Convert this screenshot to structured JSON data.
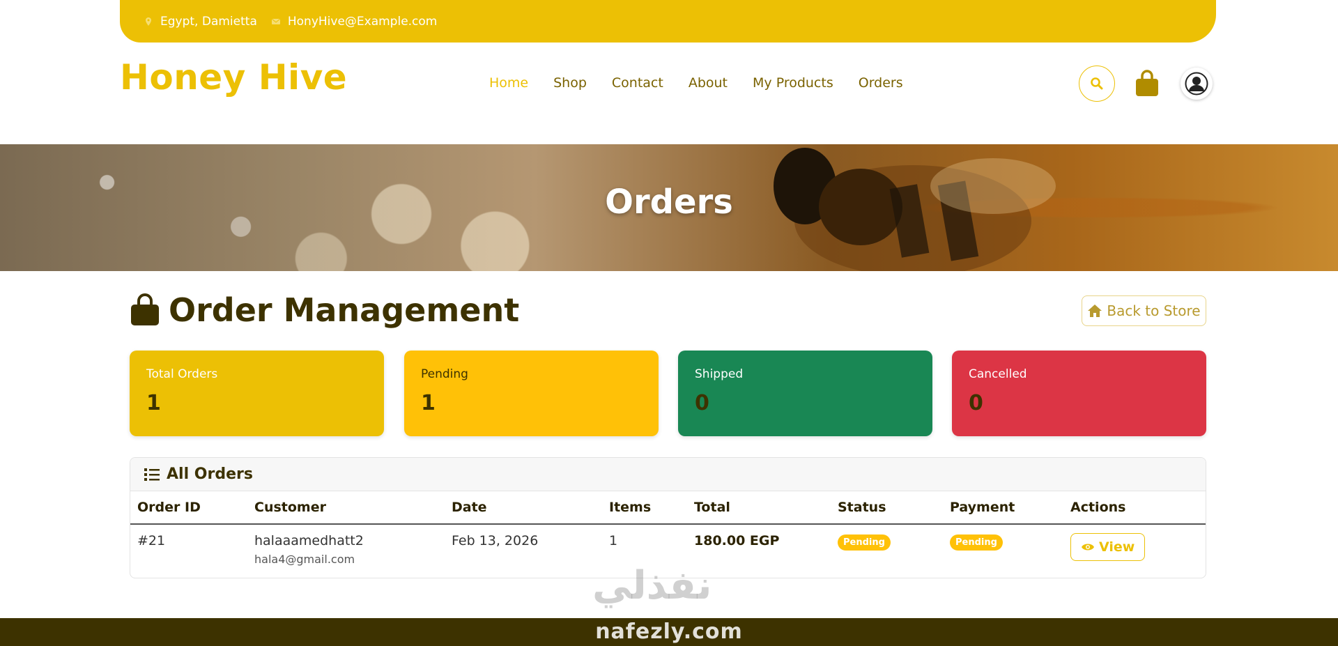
{
  "topbar": {
    "location": "Egypt, Damietta",
    "email": "HonyHive@Example.com",
    "location_icon": "map-marker-icon",
    "email_icon": "envelope-icon"
  },
  "header": {
    "brand": "Honey Hive",
    "nav": [
      "Home",
      "Shop",
      "Contact",
      "About",
      "My Products",
      "Orders"
    ],
    "active_nav": "Home"
  },
  "banner": {
    "title": "Orders"
  },
  "page": {
    "title": "Order Management",
    "back_button": "Back to Store"
  },
  "stats": [
    {
      "label": "Total Orders",
      "value": "1",
      "color": "#ecc005"
    },
    {
      "label": "Pending",
      "value": "1",
      "color": "#ffc107"
    },
    {
      "label": "Shipped",
      "value": "0",
      "color": "#198754"
    },
    {
      "label": "Cancelled",
      "value": "0",
      "color": "#dc3545"
    }
  ],
  "orders": {
    "title": "All Orders",
    "columns": [
      "Order ID",
      "Customer",
      "Date",
      "Items",
      "Total",
      "Status",
      "Payment",
      "Actions"
    ],
    "rows": [
      {
        "id": "#21",
        "customer": "halaaamedhatt2",
        "customer_email": "hala4@gmail.com",
        "date": "Feb 13, 2026",
        "items": "1",
        "total": "180.00 EGP",
        "status": "Pending",
        "payment": "Pending",
        "action": "View"
      }
    ]
  },
  "watermark": {
    "arabic": "نفذلي",
    "latin": "nafezly.com"
  },
  "colors": {
    "accent": "#ecc005",
    "dark": "#3d3200",
    "footer": "#3d3200"
  }
}
